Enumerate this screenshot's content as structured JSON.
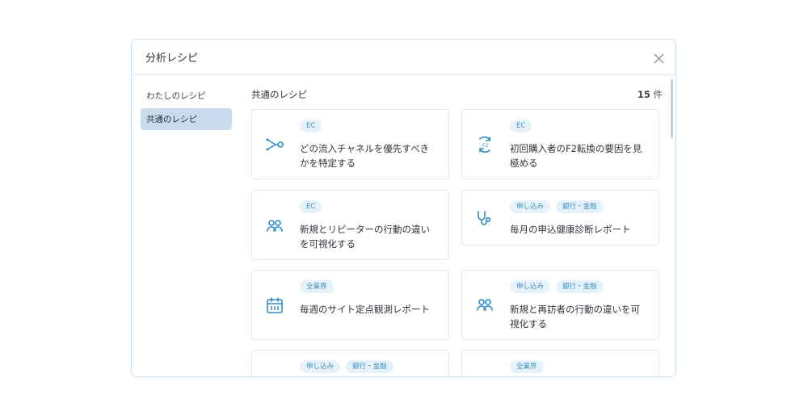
{
  "modal": {
    "title": "分析レシピ"
  },
  "sidebar": {
    "items": [
      {
        "label": "わたしのレシピ",
        "active": false
      },
      {
        "label": "共通のレシピ",
        "active": true
      }
    ]
  },
  "main": {
    "section_title": "共通のレシピ",
    "count_number": "15",
    "count_unit": "件"
  },
  "cards": [
    {
      "tags": [
        "EC"
      ],
      "title": "どの流入チャネルを優先すべきかを特定する",
      "icon": "channel-branch-icon"
    },
    {
      "tags": [
        "EC"
      ],
      "title": "初回購入者のF2転換の要因を見極める",
      "icon": "f2-cycle-icon"
    },
    {
      "tags": [
        "EC"
      ],
      "title": "新規とリピーターの行動の違いを可視化する",
      "icon": "users-icon"
    },
    {
      "tags": [
        "申し込み",
        "銀行・金融"
      ],
      "title": "毎月の申込健康診断レポート",
      "icon": "stethoscope-icon"
    },
    {
      "tags": [
        "全業界"
      ],
      "title": "毎週のサイト定点観測レポート",
      "icon": "calendar-icon"
    },
    {
      "tags": [
        "申し込み",
        "銀行・金融"
      ],
      "title": "新規と再訪者の行動の違いを可視化する",
      "icon": "users-icon"
    },
    {
      "tags": [
        "申し込み",
        "銀行・金融"
      ],
      "title": "",
      "icon": ""
    },
    {
      "tags": [
        "全業界"
      ],
      "title": "",
      "icon": ""
    }
  ],
  "colors": {
    "accent": "#2e8cc8",
    "active_bg": "#c9dcee",
    "tag_bg": "#e6f2fa",
    "tag_text": "#3d8fbf"
  }
}
